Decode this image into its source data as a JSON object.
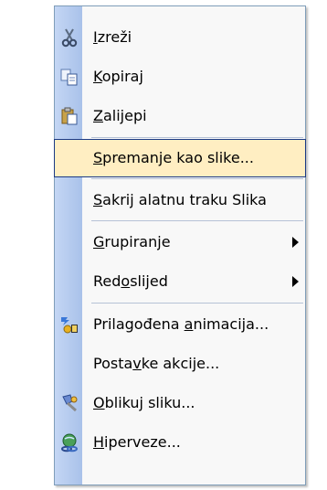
{
  "menu": {
    "items": [
      {
        "id": "cut",
        "label": "Izreži",
        "accel": "I",
        "icon": "scissors-icon",
        "separator_after": false,
        "submenu": false,
        "highlighted": false
      },
      {
        "id": "copy",
        "label": "Kopiraj",
        "accel": "K",
        "icon": "copy-icon",
        "separator_after": false,
        "submenu": false,
        "highlighted": false
      },
      {
        "id": "paste",
        "label": "Zalijepi",
        "accel": "Z",
        "icon": "paste-icon",
        "separator_after": true,
        "submenu": false,
        "highlighted": false
      },
      {
        "id": "save-as-image",
        "label": "Spremanje kao slike...",
        "accel": "S",
        "icon": "",
        "separator_after": true,
        "submenu": false,
        "highlighted": true
      },
      {
        "id": "hide-toolbar",
        "label": "Sakrij alatnu traku Slika",
        "accel": "S",
        "icon": "",
        "separator_after": true,
        "submenu": false,
        "highlighted": false
      },
      {
        "id": "grouping",
        "label": "Grupiranje",
        "accel": "G",
        "icon": "",
        "separator_after": false,
        "submenu": true,
        "highlighted": false
      },
      {
        "id": "order",
        "label": "Redoslijed",
        "accel": "o",
        "icon": "",
        "separator_after": true,
        "submenu": true,
        "highlighted": false
      },
      {
        "id": "custom-animation",
        "label": "Prilagođena animacija...",
        "accel": "a",
        "icon": "animation-icon",
        "separator_after": false,
        "submenu": false,
        "highlighted": false
      },
      {
        "id": "action-settings",
        "label": "Postavke akcije...",
        "accel": "v",
        "icon": "",
        "separator_after": false,
        "submenu": false,
        "highlighted": false
      },
      {
        "id": "format-picture",
        "label": "Oblikuj sliku...",
        "accel": "O",
        "icon": "format-picture-icon",
        "separator_after": false,
        "submenu": false,
        "highlighted": false
      },
      {
        "id": "hyperlink",
        "label": "Hiperveze...",
        "accel": "H",
        "icon": "hyperlink-icon",
        "separator_after": false,
        "submenu": false,
        "highlighted": false
      }
    ]
  },
  "colors": {
    "highlight_bg": "#ffeec2",
    "highlight_border": "#1b3a86",
    "gutter": "#b9cdef",
    "separator": "#b6c2d6"
  }
}
